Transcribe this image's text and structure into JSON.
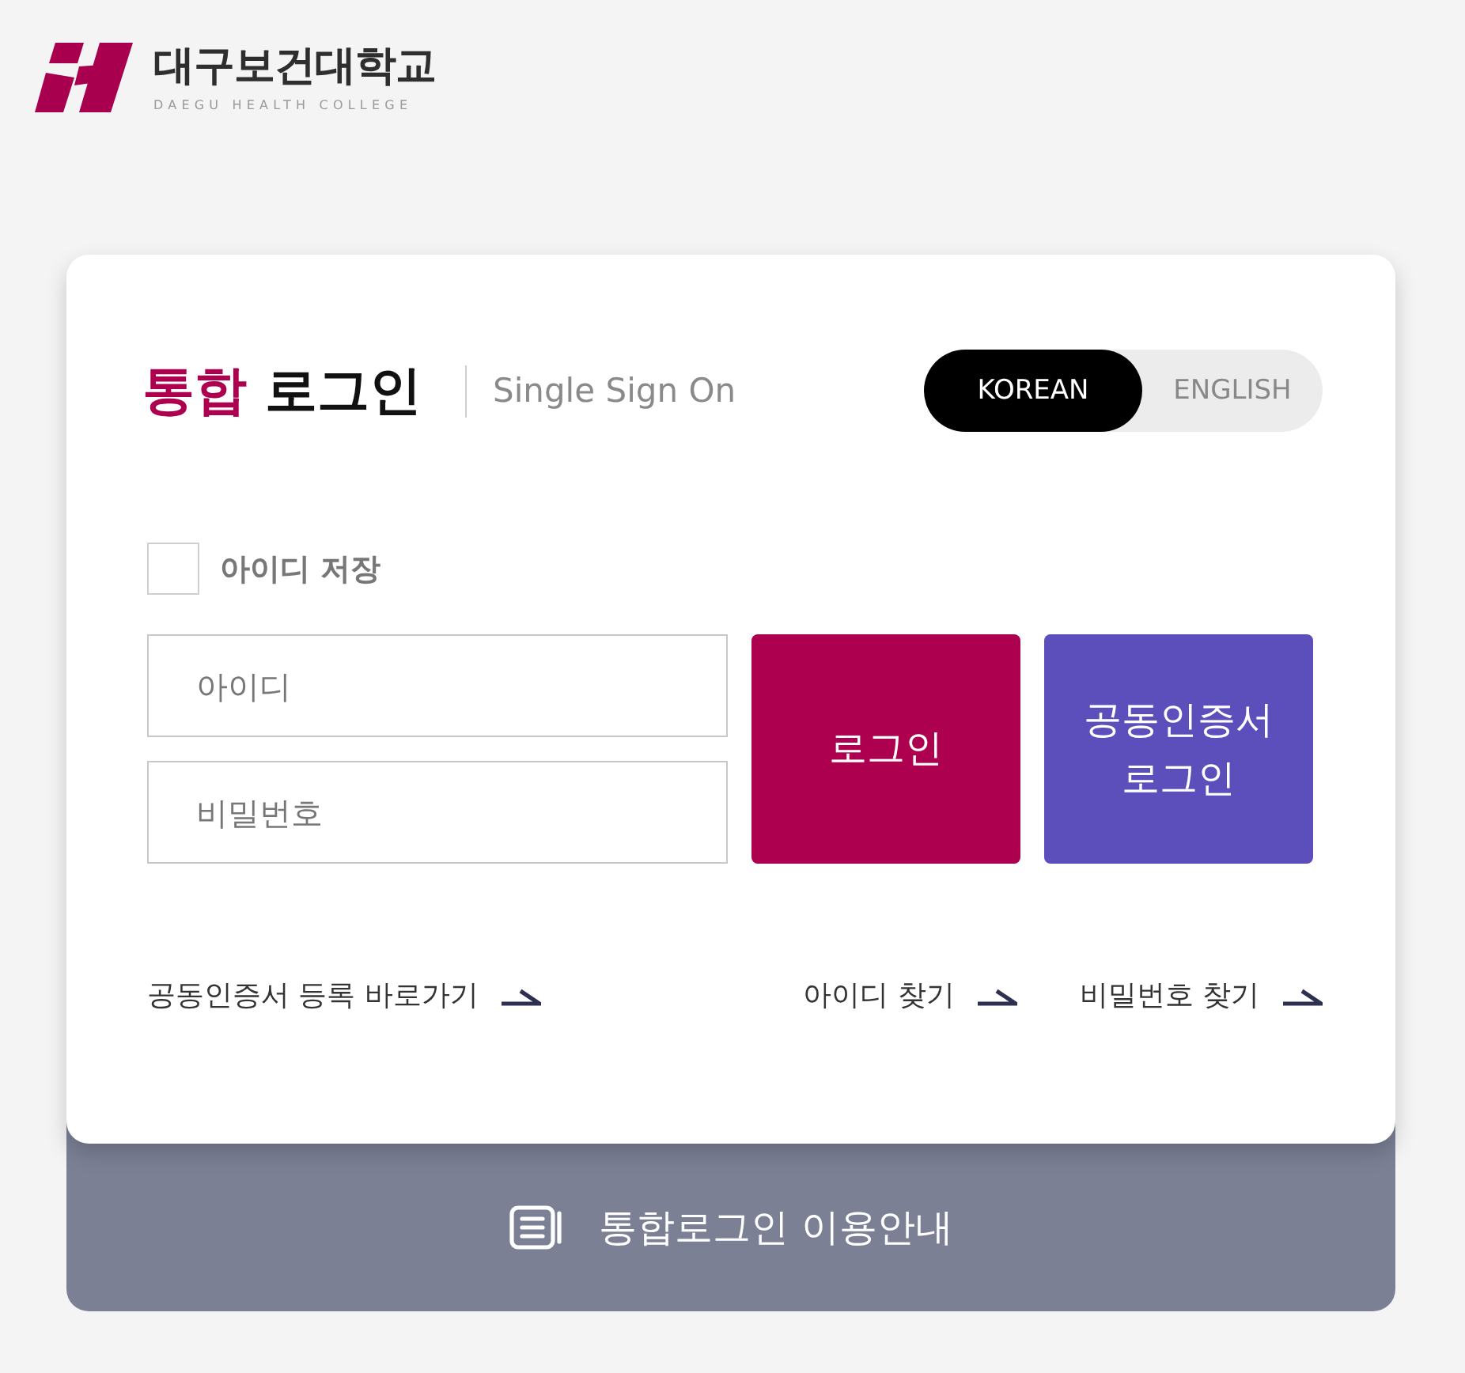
{
  "logo": {
    "name": "대구보건대학교",
    "subtitle": "DAEGU HEALTH COLLEGE"
  },
  "login_card": {
    "title_parts": [
      {
        "text": "통합",
        "accent": true
      },
      {
        "text": "로그인",
        "accent": false
      }
    ],
    "subtitle": "Single Sign On",
    "language_tabs": [
      {
        "label": "KOREAN",
        "selected": true
      },
      {
        "label": "ENGLISH",
        "selected": false
      }
    ],
    "remember_id": {
      "label": "아이디 저장",
      "checked": false
    },
    "fields": [
      {
        "placeholder": "아이디"
      },
      {
        "placeholder": "비밀번호"
      }
    ],
    "buttons": [
      {
        "kind": "primary",
        "label": "로그인"
      },
      {
        "kind": "certificate",
        "label": "공동인증서 로그인"
      }
    ],
    "links": [
      {
        "label": "공동인증서 등록 바로가기"
      },
      {
        "label": "아이디 찾기"
      },
      {
        "label": "비밀번호 찾기"
      }
    ]
  },
  "guide_bar": {
    "label": "통합로그인 이용안내"
  }
}
